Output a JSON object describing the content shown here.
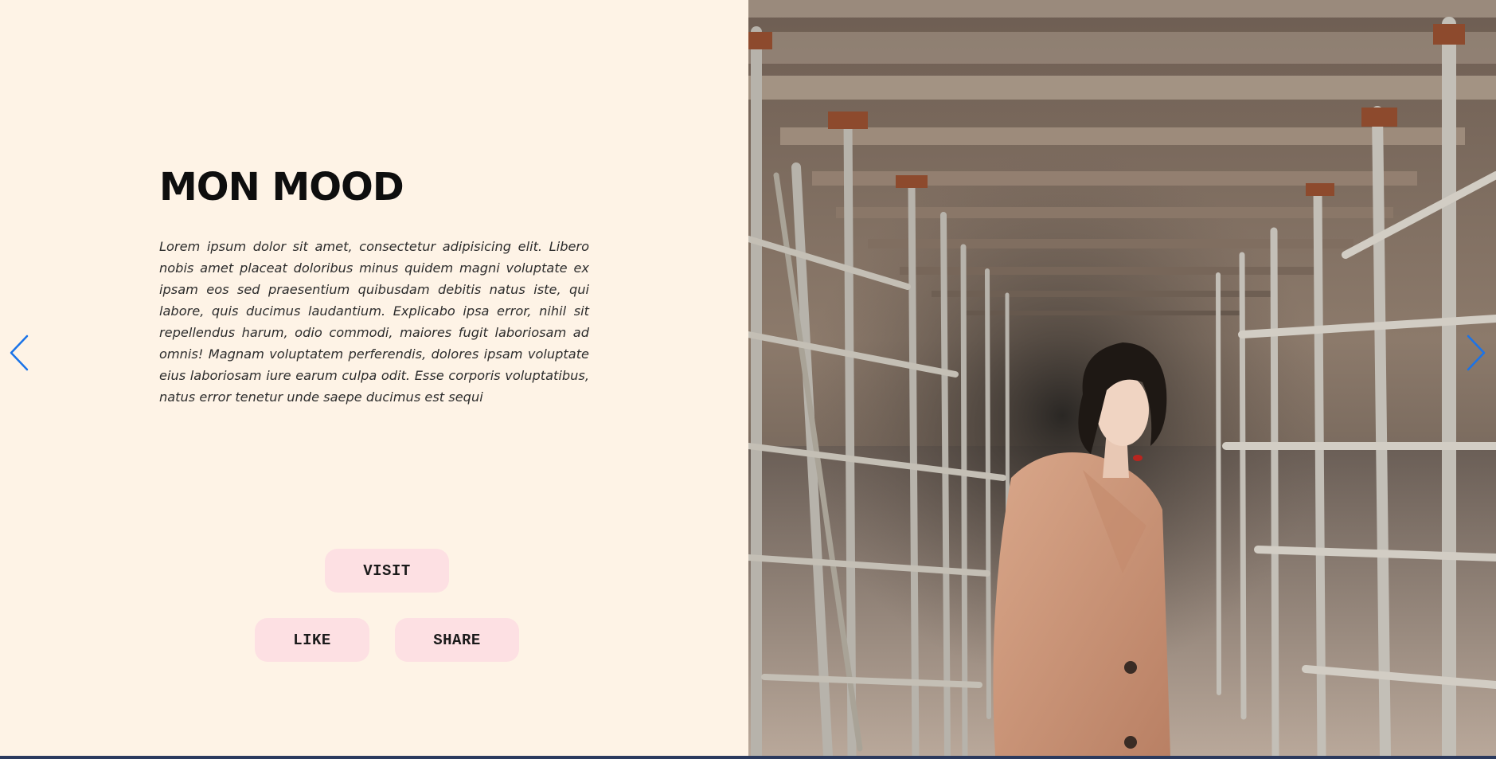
{
  "slide": {
    "title": "MON MOOD",
    "description": "Lorem ipsum dolor sit amet, consectetur adipisicing elit. Libero nobis amet placeat doloribus minus quidem magni voluptate ex ipsam eos sed praesentium quibusdam debitis natus iste, qui labore, quis ducimus laudantium. Explicabo ipsa error, nihil sit repellendus harum, odio commodi, maiores fugit laboriosam ad omnis! Magnam voluptatem perferendis, dolores ipsam voluptate eius laboriosam iure earum culpa odit. Esse corporis voluptatibus, natus error tenetur unde saepe ducimus est sequi",
    "buttons": {
      "visit_label": "VISIT",
      "like_label": "LIKE",
      "share_label": "SHARE"
    }
  },
  "navigation": {
    "prev_icon": "chevron-left-icon",
    "next_icon": "chevron-right-icon",
    "arrow_color": "#1a73e8"
  },
  "colors": {
    "panel_background": "#fef3e6",
    "button_background": "#fde0e3",
    "bottom_bar": "#2b3a5e"
  }
}
